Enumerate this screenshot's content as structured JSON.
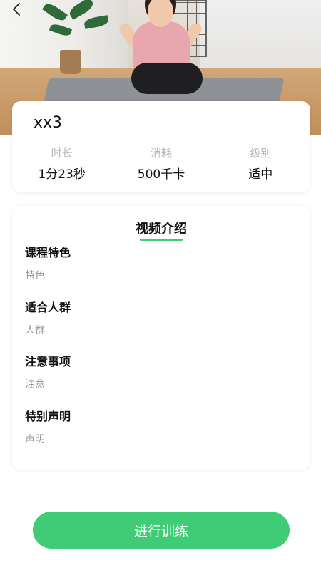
{
  "course": {
    "title": "xx3"
  },
  "stats": [
    {
      "label": "时长",
      "value": "1分23秒"
    },
    {
      "label": "消耗",
      "value": "500千卡"
    },
    {
      "label": "级别",
      "value": "适中"
    }
  ],
  "intro": {
    "tab_label": "视频介绍",
    "sections": [
      {
        "heading": "课程特色",
        "body": "特色"
      },
      {
        "heading": "适合人群",
        "body": "人群"
      },
      {
        "heading": "注意事项",
        "body": "注意"
      },
      {
        "heading": "特别声明",
        "body": "声明"
      }
    ]
  },
  "actions": {
    "start_label": "进行训练"
  },
  "icons": {
    "back": "back-arrow-icon"
  },
  "colors": {
    "accent": "#40cc77",
    "underline": "#3fcc76"
  }
}
